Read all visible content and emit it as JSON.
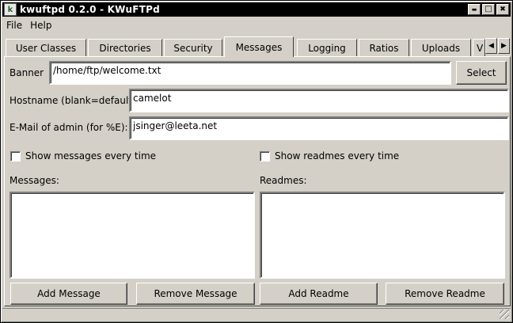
{
  "window": {
    "icon": "k-app-icon",
    "title": "kwuftpd 0.2.0 - KWuFTPd",
    "minimize_glyph": "▬",
    "maximize_glyph": "□",
    "close_glyph": "✖"
  },
  "menu": {
    "file": "File",
    "help": "Help"
  },
  "tabs": [
    {
      "label": "User Classes"
    },
    {
      "label": "Directories"
    },
    {
      "label": "Security"
    },
    {
      "label": "Messages",
      "active": true
    },
    {
      "label": "Logging"
    },
    {
      "label": "Ratios"
    },
    {
      "label": "Uploads"
    },
    {
      "label": "V"
    }
  ],
  "tab_scroll": {
    "left": "◀",
    "right": "▶"
  },
  "form": {
    "banner_label": "Banner",
    "banner_value": "/home/ftp/welcome.txt",
    "select_button": "Select",
    "hostname_label": "Hostname (blank=default)",
    "hostname_value": "camelot",
    "email_label": "E-Mail of admin (for %E):",
    "email_value": "jsinger@leeta.net",
    "show_messages": "Show messages every time",
    "show_readmes": "Show readmes every time",
    "messages_label": "Messages:",
    "readmes_label": "Readmes:",
    "add_message": "Add Message",
    "remove_message": "Remove Message",
    "add_readme": "Add Readme",
    "remove_readme": "Remove Readme"
  }
}
